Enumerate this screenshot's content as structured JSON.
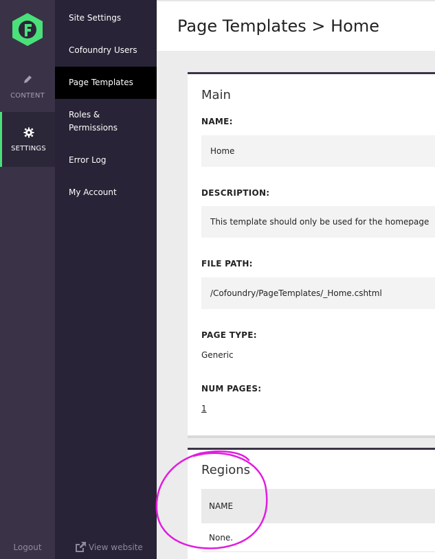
{
  "rail": {
    "items": [
      {
        "label": "CONTENT",
        "icon": "pencil-icon"
      },
      {
        "label": "SETTINGS",
        "icon": "gear-icon"
      }
    ],
    "logout_label": "Logout"
  },
  "nav": {
    "items": [
      {
        "label": "Site Settings"
      },
      {
        "label": "Cofoundry Users"
      },
      {
        "label": "Page Templates"
      },
      {
        "label": "Roles &\nPermissions"
      },
      {
        "label": "Error Log"
      },
      {
        "label": "My Account"
      }
    ],
    "view_website_label": "View website"
  },
  "header": {
    "title": "Page Templates > Home"
  },
  "main_card": {
    "title": "Main",
    "fields": [
      {
        "label": "NAME:",
        "value": "Home"
      },
      {
        "label": "DESCRIPTION:",
        "value": "This template should only be used for the homepage"
      },
      {
        "label": "FILE PATH:",
        "value": "/Cofoundry/PageTemplates/_Home.cshtml"
      },
      {
        "label": "PAGE TYPE:",
        "value": "Generic"
      },
      {
        "label": "NUM PAGES:",
        "value": "1"
      }
    ]
  },
  "regions_card": {
    "title": "Regions",
    "column_header": "NAME",
    "rows": [
      "None."
    ]
  },
  "colors": {
    "brand_green": "#4ae07a",
    "rail_bg": "#3a3347",
    "nav_bg": "#282336",
    "annotation": "#e21ce0"
  }
}
